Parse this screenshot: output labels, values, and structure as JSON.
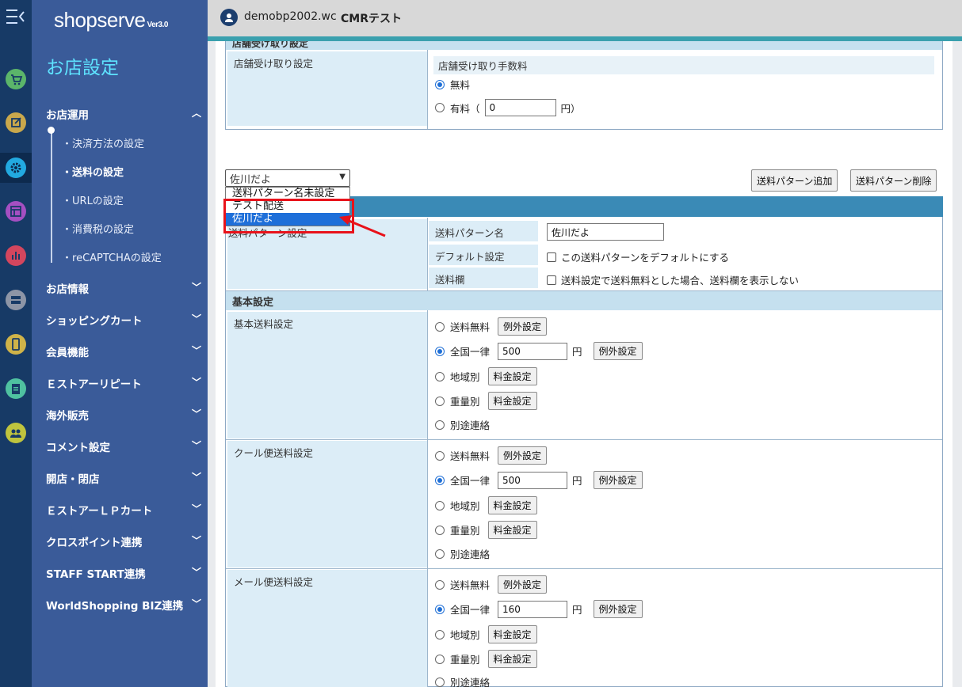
{
  "app": {
    "logo": "shopserve",
    "version": "Ver3.0",
    "section_title": "お店設定"
  },
  "topbar": {
    "user_id": "demobp2002.wc",
    "store_name": "CMRテスト"
  },
  "sidebar": {
    "open_group": "お店運用",
    "sub_items": [
      "決済方法の設定",
      "送料の設定",
      "URLの設定",
      "消費税の設定",
      "reCAPTCHAの設定"
    ],
    "active_sub": "送料の設定",
    "groups": [
      "お店情報",
      "ショッピングカート",
      "会員機能",
      "Ｅストアーリピート",
      "海外販売",
      "コメント設定",
      "開店・閉店",
      "ＥストアーＬＰカート",
      "クロスポイント連携",
      "STAFF START連携",
      "WorldShopping BIZ連携"
    ]
  },
  "store_pickup": {
    "header": "店舗受け取り設定",
    "label": "店舗受け取り設定",
    "fee_title": "店舗受け取り手数料",
    "free": "無料",
    "paid": "有料（",
    "paid_value": "0",
    "paid_unit": "円）"
  },
  "pattern_select": {
    "value": "佐川だよ",
    "options": [
      "送料パターン名未設定",
      "テスト配送",
      "佐川だよ"
    ],
    "selected": "佐川だよ",
    "partial_hidden_text": "送料パターン設定"
  },
  "buttons": {
    "add_pattern": "送料パターン追加",
    "delete_pattern": "送料パターン削除"
  },
  "pattern": {
    "name_label": "送料パターン名",
    "name_value": "佐川だよ",
    "default_label": "デフォルト設定",
    "default_checkbox": "この送料パターンをデフォルトにする",
    "column_label": "送料欄",
    "column_checkbox": "送料設定で送料無料とした場合、送料欄を表示しない"
  },
  "basic": {
    "header": "基本設定",
    "sections": [
      {
        "label": "基本送料設定",
        "flat_value": "500"
      },
      {
        "label": "クール便送料設定",
        "flat_value": "500"
      },
      {
        "label": "メール便送料設定",
        "flat_value": "160"
      }
    ],
    "options": {
      "free": "送料無料",
      "exception": "例外設定",
      "flat": "全国一律",
      "yen": "円",
      "region": "地域別",
      "rate": "料金設定",
      "weight": "重量別",
      "separate": "別途連絡"
    }
  },
  "colors": {
    "rail": "#173a66",
    "sidebar": "#3a5b99",
    "accent": "#5ee3ff",
    "highlight": "#e8121a",
    "selected": "#1e6fd9"
  }
}
